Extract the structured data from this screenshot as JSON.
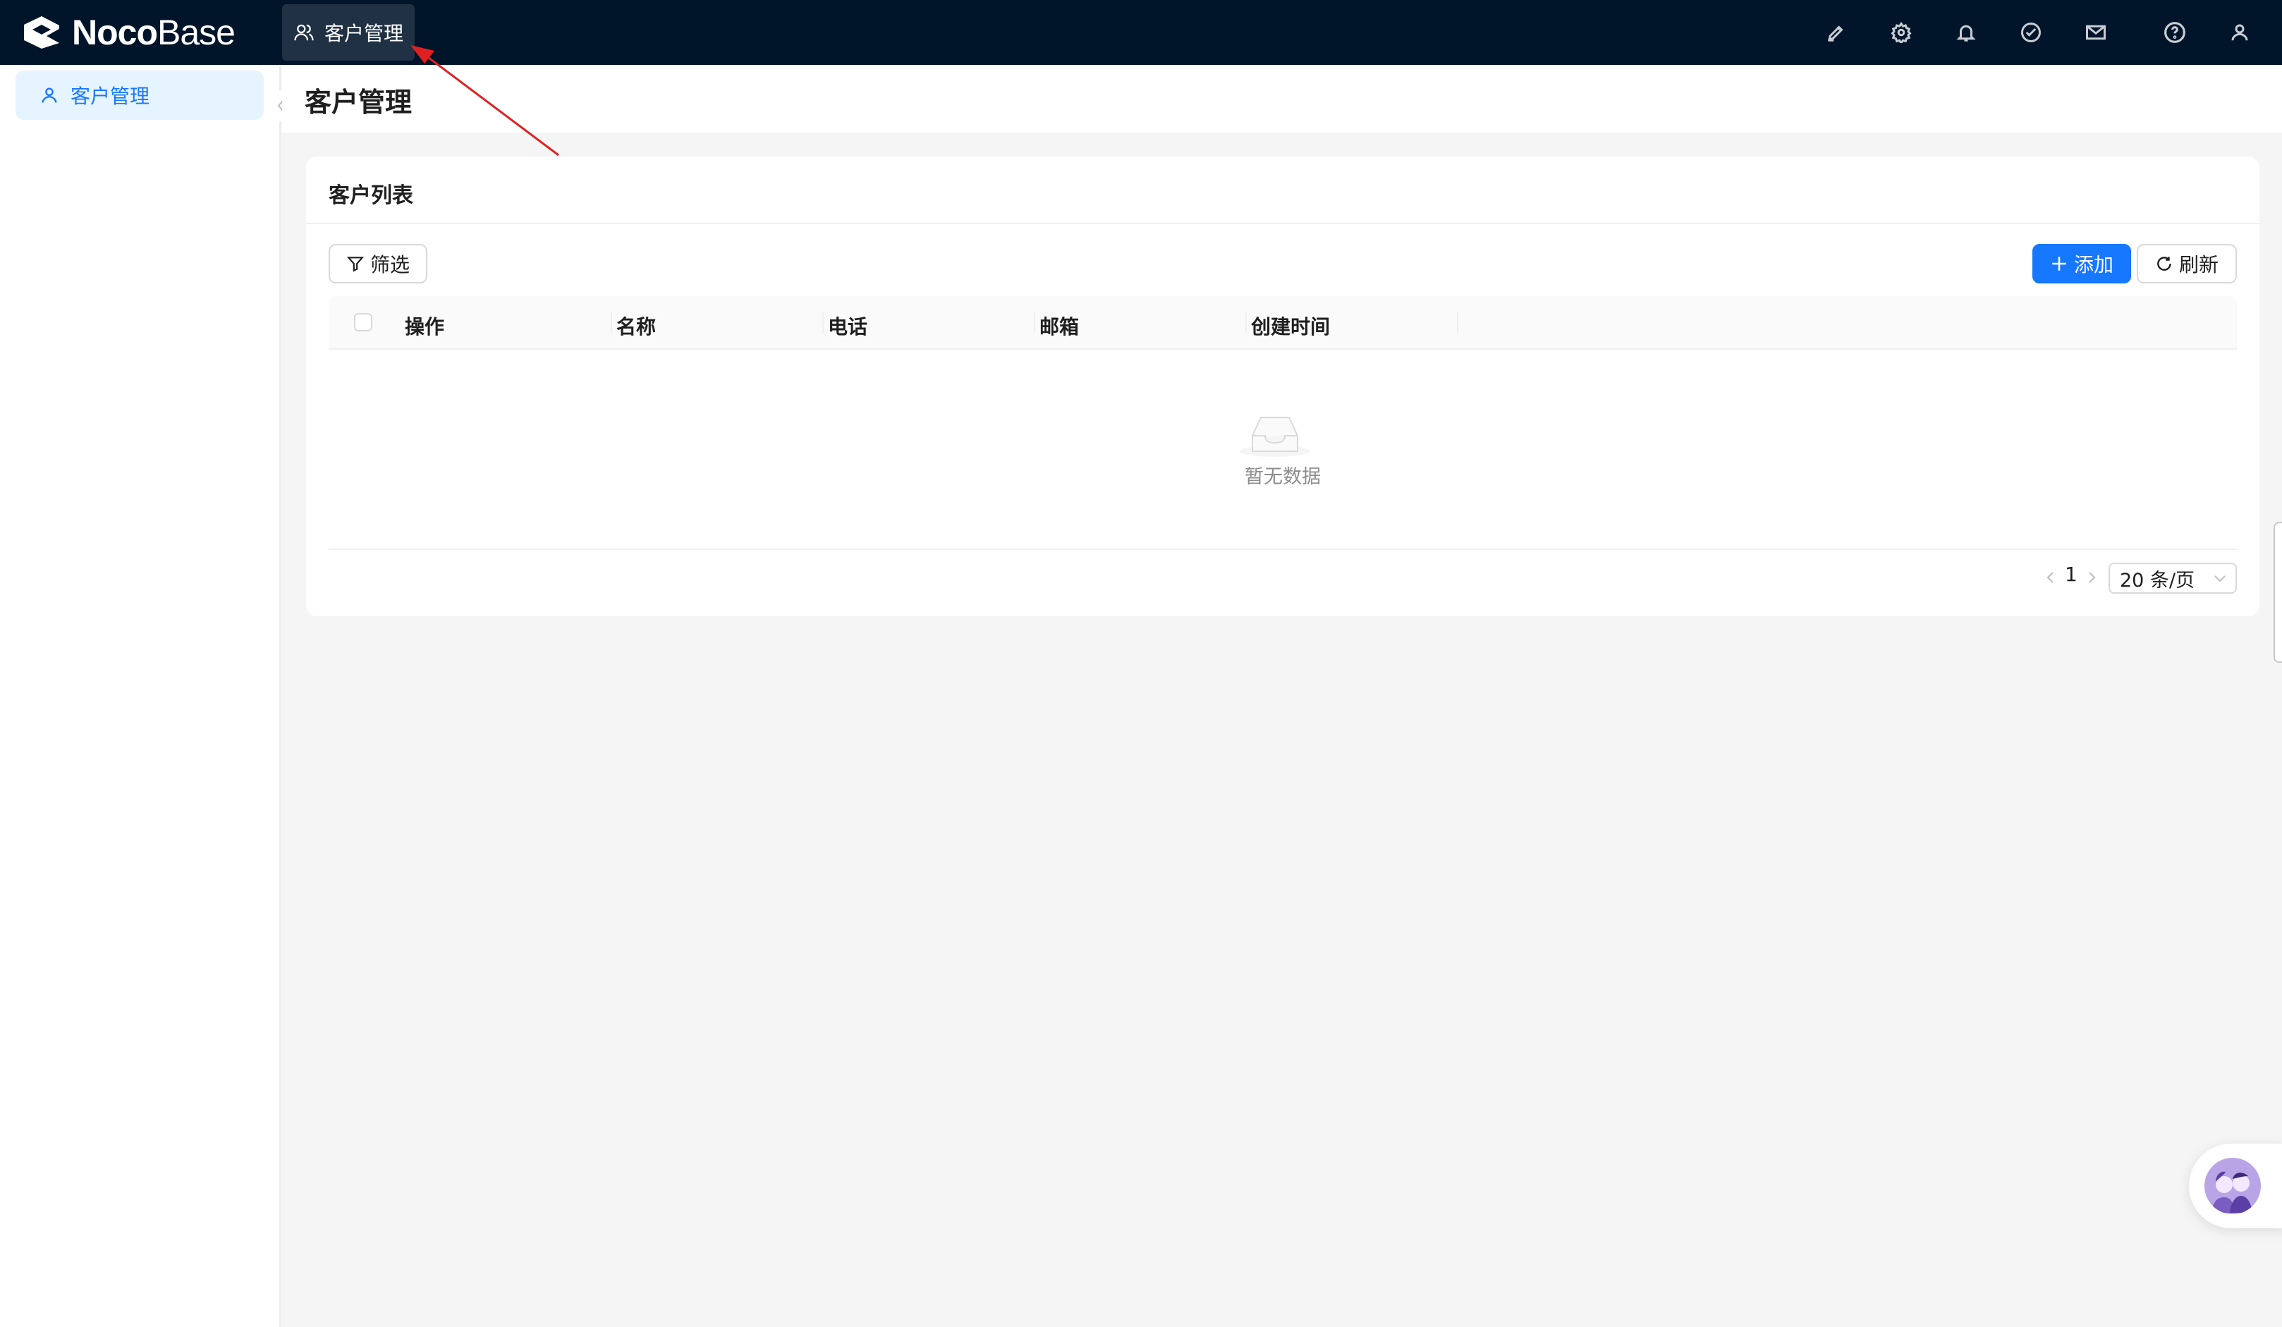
{
  "brand": {
    "part1": "Noco",
    "part2": "Base"
  },
  "top_menu": {
    "label": "客户管理",
    "icon": "user-group-icon"
  },
  "top_actions": [
    {
      "name": "theme-editor-icon"
    },
    {
      "name": "settings-icon"
    },
    {
      "name": "notification-bell-icon"
    },
    {
      "name": "workflow-todo-icon"
    },
    {
      "name": "mail-icon"
    },
    {
      "name": "help-icon"
    },
    {
      "name": "user-profile-icon"
    }
  ],
  "sidebar": {
    "items": [
      {
        "label": "客户管理",
        "icon": "user-icon",
        "active": true
      }
    ]
  },
  "page": {
    "title": "客户管理"
  },
  "card": {
    "title": "客户列表",
    "filter_label": "筛选",
    "add_label": "添加",
    "refresh_label": "刷新"
  },
  "table": {
    "columns": [
      "操作",
      "名称",
      "电话",
      "邮箱",
      "创建时间"
    ],
    "rows": [],
    "empty_text": "暂无数据"
  },
  "pagination": {
    "current_page": "1",
    "page_size": "20 条/页"
  },
  "colors": {
    "header_bg": "#001529",
    "primary": "#1677ff",
    "active_bg": "#e6f4ff",
    "annotation": "#e02020"
  }
}
